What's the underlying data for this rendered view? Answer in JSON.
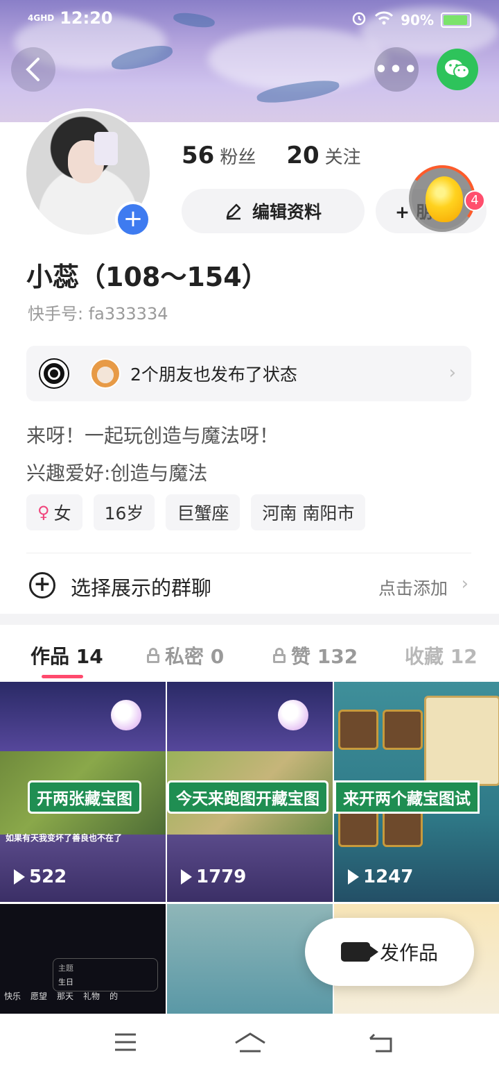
{
  "status_bar": {
    "network": "4GHD",
    "time": "12:20",
    "battery": "90%"
  },
  "header": {
    "more_label": "•••"
  },
  "profile": {
    "followers_count": "56",
    "followers_label": "粉丝",
    "following_count": "20",
    "following_label": "关注",
    "edit_label": "编辑资料",
    "add_friend_label": "+ 朋友",
    "egg_badge": "4",
    "name": "小蕊（108～154）",
    "kuaishou_id": "快手号: fa333334"
  },
  "friends_card": {
    "text": "2个朋友也发布了状态"
  },
  "bio": {
    "line1": "来呀！一起玩创造与魔法呀！",
    "line2": "兴趣爱好:创造与魔法"
  },
  "tags": [
    {
      "label": "女"
    },
    {
      "label": "16岁"
    },
    {
      "label": "巨蟹座"
    },
    {
      "label": "河南 南阳市"
    }
  ],
  "group_row": {
    "label": "选择展示的群聊",
    "action": "点击添加"
  },
  "tabs": [
    {
      "label": "作品 14"
    },
    {
      "label": "私密 0"
    },
    {
      "label": "赞 132"
    },
    {
      "label": "收藏 12"
    }
  ],
  "grid": [
    {
      "caption": "开两张藏宝图",
      "subtitle": "如果有天我变坏了善良也不在了",
      "views": "522"
    },
    {
      "caption": "今天来跑图开藏宝图",
      "views": "1779"
    },
    {
      "caption": "来开两个藏宝图试",
      "views": "1247"
    }
  ],
  "grid_row2": {
    "input_topic": "主题",
    "input_text": "生日",
    "keyboard_suggestions": [
      "快乐",
      "愿望",
      "那天",
      "礼物",
      "的"
    ]
  },
  "fab": {
    "label": "发作品"
  },
  "colors": {
    "accent_pink": "#ff4a6d",
    "wechat_green": "#2ec35b",
    "avatar_plus_blue": "#3e7bf0",
    "caption_green": "#1f8e52"
  }
}
